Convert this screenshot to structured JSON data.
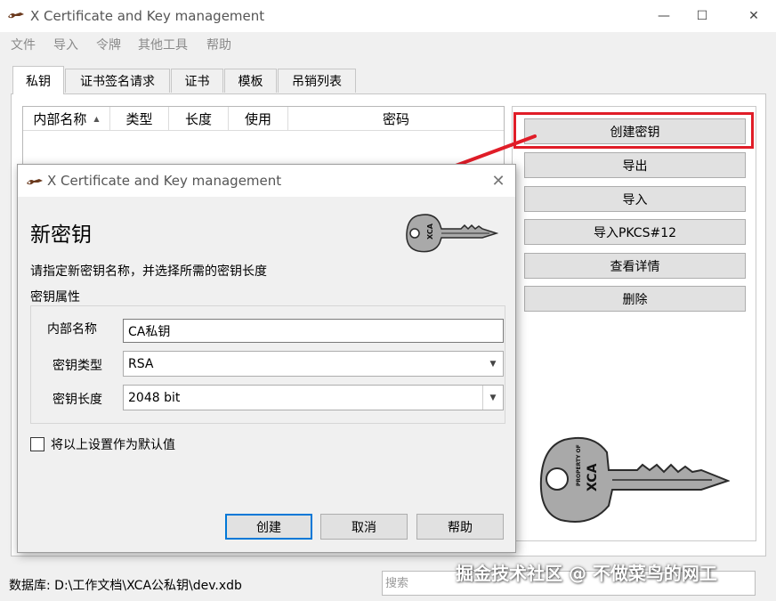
{
  "window": {
    "title": "X Certificate and Key management",
    "minimize_glyph": "—",
    "maximize_glyph": "☐",
    "close_glyph": "✕"
  },
  "menu": {
    "items": [
      {
        "label": "文件"
      },
      {
        "label": "导入"
      },
      {
        "label": "令牌"
      },
      {
        "label": "其他工具"
      },
      {
        "label": "帮助"
      }
    ]
  },
  "tabs": [
    {
      "label": "私钥",
      "active": true
    },
    {
      "label": "证书签名请求",
      "active": false
    },
    {
      "label": "证书",
      "active": false
    },
    {
      "label": "模板",
      "active": false
    },
    {
      "label": "吊销列表",
      "active": false
    }
  ],
  "key_list": {
    "columns": [
      {
        "label": "内部名称",
        "sort": "ascending"
      },
      {
        "label": "类型"
      },
      {
        "label": "长度"
      },
      {
        "label": "使用"
      },
      {
        "label": "密码"
      }
    ],
    "sort_indicator": "▲",
    "rows": []
  },
  "actions": {
    "create_key": "创建密钥",
    "export": "导出",
    "import": "导入",
    "import_pkcs12": "导入PKCS#12",
    "view_details": "查看详情",
    "delete": "删除"
  },
  "status": {
    "database_label": "数据库: D:\\工作文档\\XCA公私钥\\dev.xdb",
    "search_placeholder": "搜索"
  },
  "watermark": "掘金技术社区 @ 不做菜鸟的网工",
  "dialog": {
    "title": "X Certificate and Key management",
    "close_glyph": "✕",
    "heading": "新密钥",
    "description": "请指定新密钥名称，并选择所需的密钥长度",
    "group_label": "密钥属性",
    "fields": {
      "internal_name": {
        "label": "内部名称",
        "value": "CA私钥"
      },
      "key_type": {
        "label": "密钥类型",
        "value": "RSA"
      },
      "key_length": {
        "label": "密钥长度",
        "value": "2048 bit"
      }
    },
    "default_checkbox": {
      "label": "将以上设置作为默认值",
      "checked": false
    },
    "buttons": {
      "create": "创建",
      "cancel": "取消",
      "help": "帮助"
    }
  },
  "key_illustration": {
    "label_small": "PROPERTY OF",
    "label_large": "XCA"
  },
  "colors": {
    "highlight": "#e01d28",
    "arrow": "#e01d28",
    "key_fill": "#a9a9a9"
  }
}
